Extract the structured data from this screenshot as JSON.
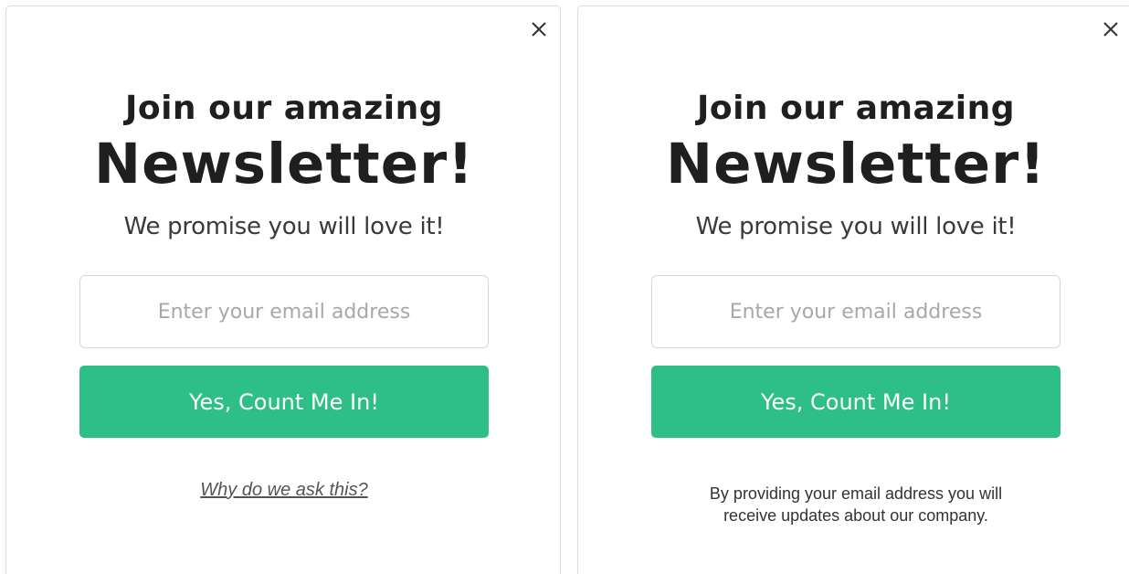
{
  "variants": [
    {
      "headline_small": "Join our amazing",
      "headline_big": "Newsletter!",
      "subline": "We promise you will love it!",
      "email_placeholder": "Enter your email address",
      "cta_label": "Yes, Count Me In!",
      "footer_link": "Why do we ask this?"
    },
    {
      "headline_small": "Join our amazing",
      "headline_big": "Newsletter!",
      "subline": "We promise you will love it!",
      "email_placeholder": "Enter your email address",
      "cta_label": "Yes, Count Me In!",
      "disclaimer_line1": "By providing your email address you will",
      "disclaimer_line2": "receive updates about our company."
    }
  ],
  "icons": {
    "close": "close-icon"
  },
  "colors": {
    "cta_background": "#2dbf86",
    "cta_text": "#ffffff",
    "headline": "#1f1f1f",
    "panel_border": "#dcdcdc"
  }
}
